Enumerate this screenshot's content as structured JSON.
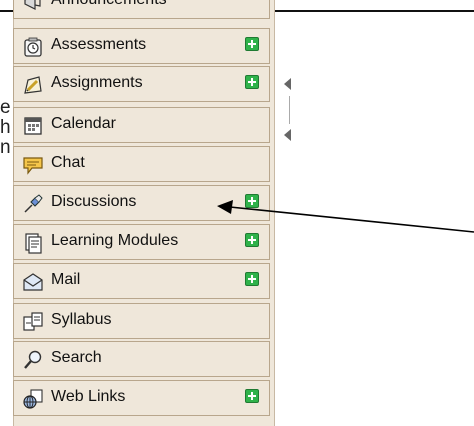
{
  "left_fragments": [
    "e",
    "h",
    "n"
  ],
  "menu": {
    "items": [
      {
        "label": "Announcements",
        "icon": "megaphone-icon",
        "badge": false
      },
      {
        "label": "Assessments",
        "icon": "clock-icon",
        "badge": true
      },
      {
        "label": "Assignments",
        "icon": "pencil-paper-icon",
        "badge": true
      },
      {
        "label": "Calendar",
        "icon": "calendar-icon",
        "badge": false
      },
      {
        "label": "Chat",
        "icon": "chat-bubble-icon",
        "badge": false
      },
      {
        "label": "Discussions",
        "icon": "pushpin-icon",
        "badge": true
      },
      {
        "label": "Learning Modules",
        "icon": "document-stack-icon",
        "badge": true
      },
      {
        "label": "Mail",
        "icon": "envelope-icon",
        "badge": true
      },
      {
        "label": "Syllabus",
        "icon": "syllabus-icon",
        "badge": false
      },
      {
        "label": "Search",
        "icon": "magnifier-icon",
        "badge": false
      },
      {
        "label": "Web Links",
        "icon": "globe-icon",
        "badge": true
      }
    ]
  },
  "colors": {
    "menu_bg": "#efe7da",
    "menu_border": "#b8a68c",
    "badge_green": "#2fb24a"
  }
}
